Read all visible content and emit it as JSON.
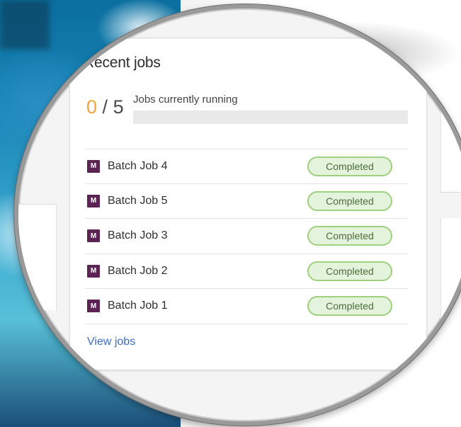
{
  "recent_jobs": {
    "title": "Recent jobs",
    "running_count": "0",
    "running_total": "5",
    "running_separator": "/",
    "running_label": "Jobs currently running",
    "running_fraction": 0,
    "jobs": [
      {
        "icon": "M",
        "name": "Batch Job 4",
        "status": "Completed"
      },
      {
        "icon": "M",
        "name": "Batch Job 5",
        "status": "Completed"
      },
      {
        "icon": "M",
        "name": "Batch Job 3",
        "status": "Completed"
      },
      {
        "icon": "M",
        "name": "Batch Job 2",
        "status": "Completed"
      },
      {
        "icon": "M",
        "name": "Batch Job 1",
        "status": "Completed"
      }
    ],
    "view_link": "View jobs"
  },
  "colors": {
    "accent_orange": "#f3a23a",
    "job_icon": "#5b2452",
    "status_fill": "#e4f4dc",
    "status_border": "#9ed07e",
    "link": "#3d6dc9"
  },
  "icons": {
    "job": "job-type-m-icon"
  }
}
